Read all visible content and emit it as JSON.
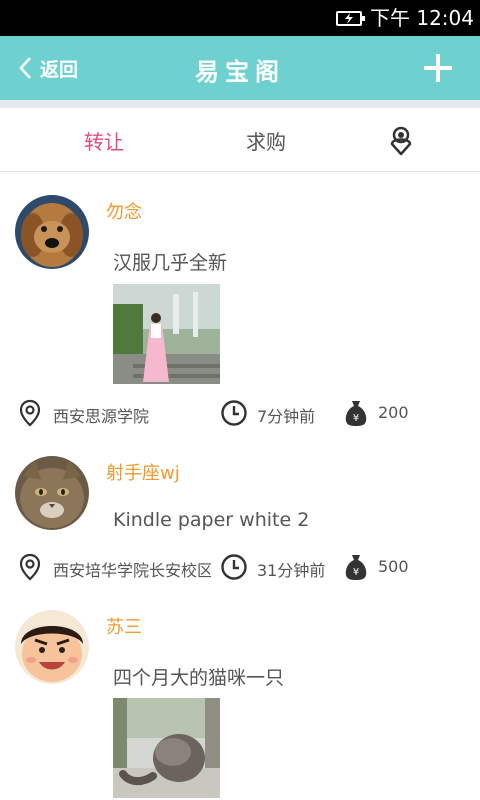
{
  "status_bar": {
    "time": "下午 12:04",
    "battery_icon": "battery-charging-icon"
  },
  "nav": {
    "back_label": "返回",
    "title": "易宝阁",
    "add_icon": "plus-icon"
  },
  "tabs": [
    {
      "label": "转让",
      "active": true
    },
    {
      "label": "求购",
      "active": false
    },
    {
      "label": "",
      "icon": "location-user-icon"
    }
  ],
  "colors": {
    "accent": "#6fd0d0",
    "active_tab": "#e34d78",
    "username": "#f19a2f"
  },
  "posts": [
    {
      "user": "勿念",
      "text": "汉服几乎全新",
      "location": "西安思源学院",
      "time": "7分钟前",
      "price": "200",
      "has_image": true
    },
    {
      "user": "射手座wj",
      "text": "Kindle paper white 2",
      "location": "西安培华学院长安校区",
      "time": "31分钟前",
      "price": "500",
      "has_image": false
    },
    {
      "user": "苏三",
      "text": "四个月大的猫咪一只",
      "has_image": true
    }
  ]
}
